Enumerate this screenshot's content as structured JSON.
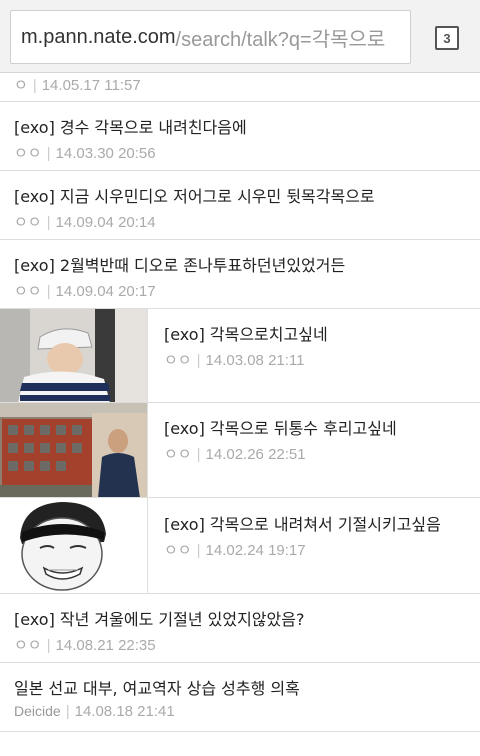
{
  "browser": {
    "url_host": "m.pann.nate.com",
    "url_path": "/search/talk?q=각목으로",
    "tab_count": "3"
  },
  "posts": [
    {
      "title": "",
      "author": "ㅇ",
      "time": "14.05.17 11:57"
    },
    {
      "title": "[exo] 경수 각목으로 내려친다음에",
      "author": "ㅇㅇ",
      "time": "14.03.30 20:56"
    },
    {
      "title": "[exo] 지금 시우민디오 저어그로 시우민 뒷목각목으로",
      "author": "ㅇㅇ",
      "time": "14.09.04 20:14"
    },
    {
      "title": "[exo] 2월벽반때 디오로 존나투표하던년있었거든",
      "author": "ㅇㅇ",
      "time": "14.09.04 20:17"
    },
    {
      "title": "[exo] 각목으로치고싶네",
      "author": "ㅇㅇ",
      "time": "14.03.08 21:11"
    },
    {
      "title": "[exo] 각목으로 뒤통수 후리고싶네",
      "author": "ㅇㅇ",
      "time": "14.02.26 22:51"
    },
    {
      "title": "[exo] 각목으로 내려쳐서 기절시키고싶음",
      "author": "ㅇㅇ",
      "time": "14.02.24 19:17"
    },
    {
      "title": "[exo] 작년 겨울에도 기절년 있었지않았음?",
      "author": "ㅇㅇ",
      "time": "14.08.21 22:35"
    },
    {
      "title": "일본 선교 대부, 여교역자 상습 성추행 의혹",
      "author": "Deicide",
      "time": "14.08.18 21:41"
    }
  ],
  "colors": {
    "accent_text": "#222222",
    "meta_text": "#aaaaaa",
    "divider": "#dedede"
  }
}
